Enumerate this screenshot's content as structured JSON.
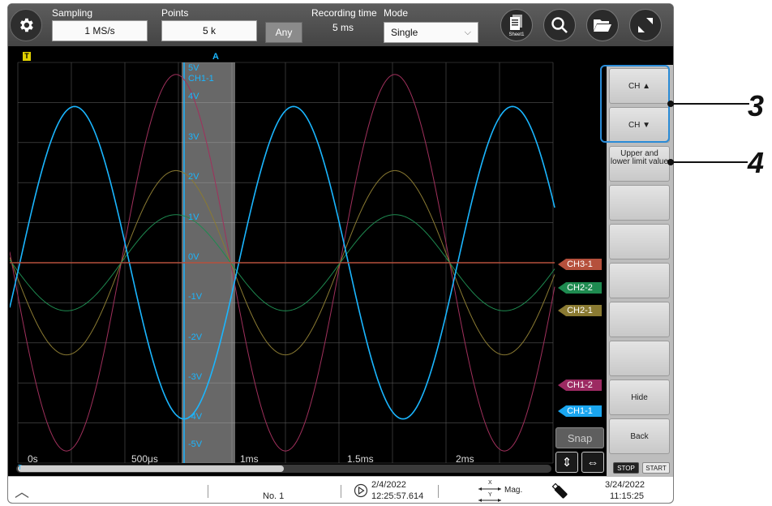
{
  "toolbar": {
    "sampling_label": "Sampling",
    "sampling_value": "1 MS/s",
    "points_label": "Points",
    "points_value": "5 k",
    "any_label": "Any",
    "recording_time_label": "Recording time",
    "recording_time_value": "5 ms",
    "mode_label": "Mode",
    "mode_value": "Single",
    "sheet_label": "Sheet1",
    "icons": [
      "gear-icon",
      "sheet-icon",
      "search-icon",
      "folder-icon",
      "expand-icon"
    ]
  },
  "graph": {
    "trigger_marker": "T",
    "cursor_label": "A",
    "channel_label": "CH1-1",
    "volt_labels": [
      "5V",
      "4V",
      "3V",
      "2V",
      "1V",
      "0V",
      "-1V",
      "-2V",
      "-3V",
      "-4V",
      "-5V"
    ],
    "time_labels": [
      "0s",
      "500μs",
      "1ms",
      "1.5ms",
      "2ms"
    ],
    "scroll_marker": "T",
    "channel_tags": [
      {
        "label": "CH3-1",
        "color": "#b5503c"
      },
      {
        "label": "CH2-2",
        "color": "#1e8a50"
      },
      {
        "label": "CH2-1",
        "color": "#8a7a32"
      },
      {
        "label": "CH1-2",
        "color": "#9c2a62"
      },
      {
        "label": "CH1-1",
        "color": "#1aa6f0"
      }
    ],
    "scroll_position": 0.5,
    "snap_label": "Snap",
    "vertical_arrows": "⇕",
    "horizontal_arrows": "⇔"
  },
  "right_panel": {
    "ch_up": "CH ▲",
    "ch_down": "CH ▼",
    "upper_lower": "Upper and lower limit value",
    "hide": "Hide",
    "back": "Back",
    "stop": "STOP",
    "start": "START"
  },
  "statusbar": {
    "up_arrow": "︿",
    "number": "No. 1",
    "trigger_date": "2/4/2022",
    "trigger_time": "12:25:57.614",
    "mag_label": "Mag.",
    "axis_x": "X",
    "axis_y": "Y",
    "date": "3/24/2022",
    "time": "11:15:25"
  },
  "callouts": {
    "c3": "3",
    "c4": "4"
  }
}
